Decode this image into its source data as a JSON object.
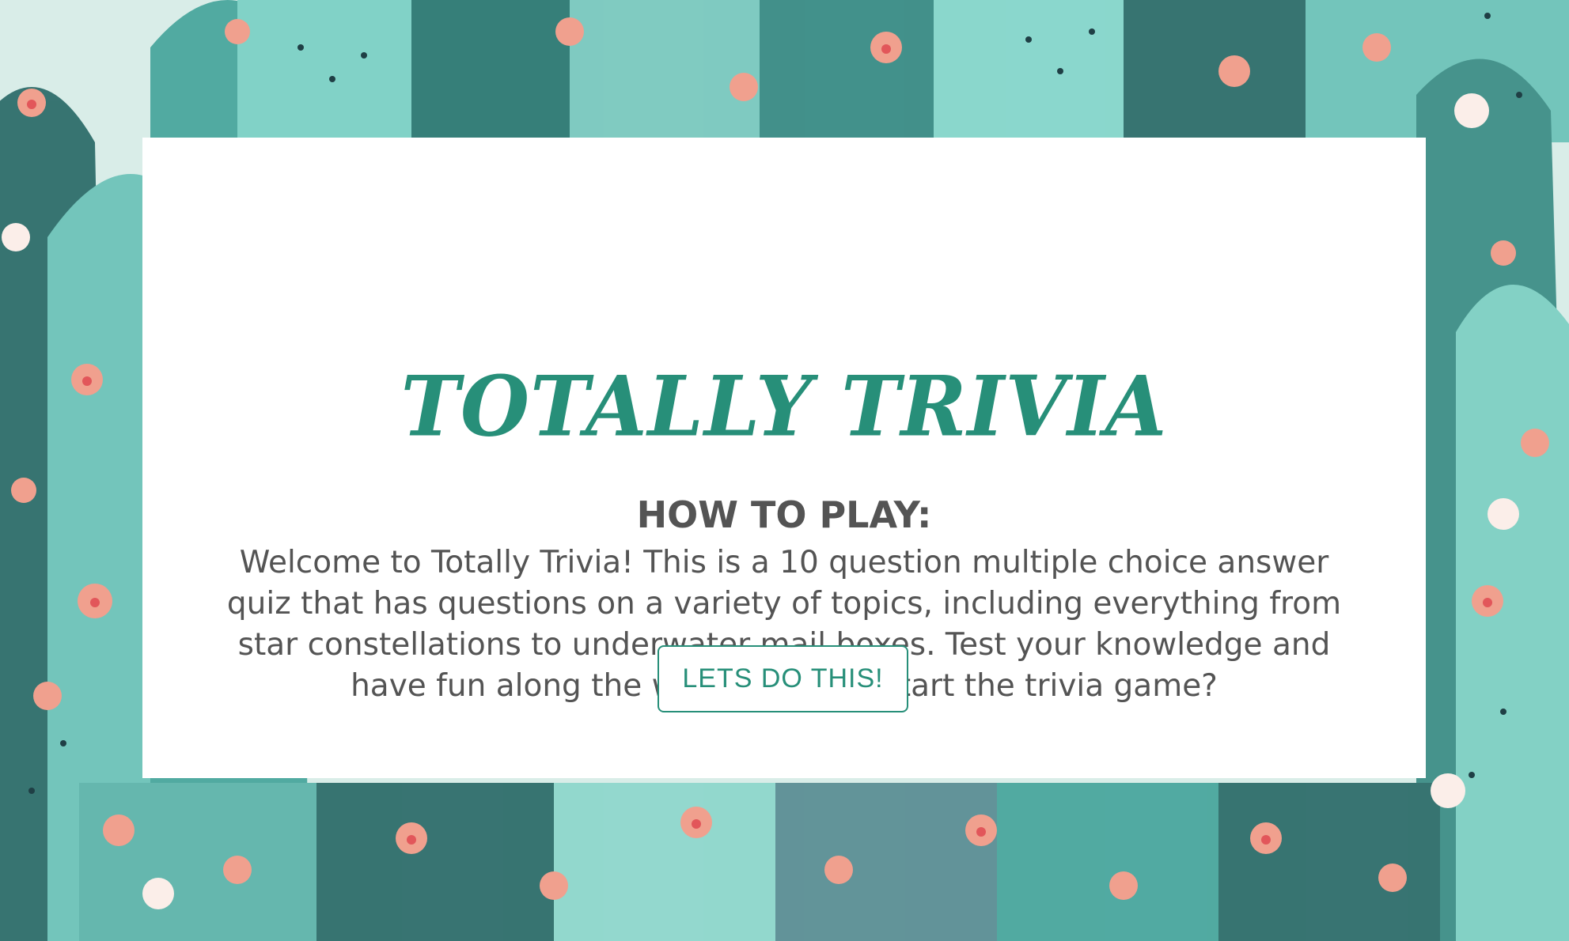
{
  "page": {
    "title": "TOTALLY TRIVIA",
    "how_to_heading": "HOW TO PLAY:",
    "intro_text": "Welcome to Totally Trivia! This is a 10 question multiple choice answer quiz that has questions on a variety of topics, including everything from star constellations to underwater mail boxes. Test your knowledge and have fun along the way! Ready to start the trivia game?",
    "start_button_label": "LETS DO THIS!"
  },
  "colors": {
    "accent": "#278f79",
    "text": "#545454",
    "card": "#ffffff"
  },
  "background": {
    "description_icon": "cactus-pattern-icon"
  }
}
